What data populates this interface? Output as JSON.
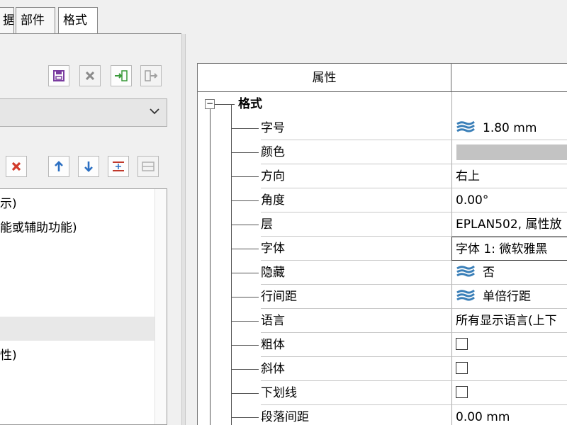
{
  "tabs": [
    "据",
    "部件",
    "格式"
  ],
  "toolbar_top": [
    "save-icon",
    "delete-icon",
    "import-icon",
    "export-icon"
  ],
  "combo": {
    "value": ""
  },
  "toolbar_mid": [
    "remove-icon",
    "move-up-icon",
    "move-down-icon",
    "insert-row-icon",
    "table-icon"
  ],
  "list_items": [
    "示)",
    "能或辅助功能)",
    "",
    "",
    "",
    "性)"
  ],
  "grid": {
    "header_col1": "属性",
    "header_col2": "",
    "section": "格式",
    "rows": [
      {
        "name": "字号",
        "value": "1.80 mm",
        "kind": "layered"
      },
      {
        "name": "颜色",
        "value": "",
        "kind": "color",
        "color": "#c3c3c3"
      },
      {
        "name": "方向",
        "value": "右上",
        "kind": "text"
      },
      {
        "name": "角度",
        "value": "0.00°",
        "kind": "text"
      },
      {
        "name": "层",
        "value": "EPLAN502, 属性放",
        "kind": "text"
      },
      {
        "name": "字体",
        "value": "字体 1: 微软雅黑",
        "kind": "edit"
      },
      {
        "name": "隐藏",
        "value": "否",
        "kind": "layered"
      },
      {
        "name": "行间距",
        "value": "单倍行距",
        "kind": "layered"
      },
      {
        "name": "语言",
        "value": "所有显示语言(上下",
        "kind": "text"
      },
      {
        "name": "粗体",
        "value": "",
        "kind": "checkbox",
        "checked": false
      },
      {
        "name": "斜体",
        "value": "",
        "kind": "checkbox",
        "checked": false
      },
      {
        "name": "下划线",
        "value": "",
        "kind": "checkbox",
        "checked": false
      },
      {
        "name": "段落间距",
        "value": "0.00 mm",
        "kind": "text"
      }
    ]
  },
  "colors": {
    "layer_icon": "#3a7fb8",
    "delete_red": "#d23a2a",
    "arrow_blue": "#2b6fc2",
    "save_purple": "#7a3ca0",
    "import_green": "#3a9a3a"
  }
}
